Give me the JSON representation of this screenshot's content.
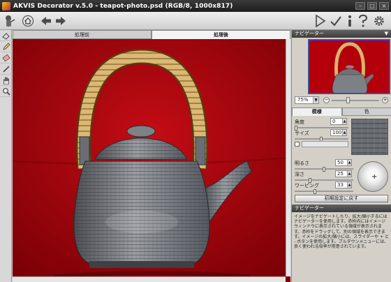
{
  "window": {
    "title": "AKVIS Decorator v.5.0 - teapot-photo.psd (RGB/8, 1000x817)",
    "controls": [
      "–",
      "□",
      "×"
    ]
  },
  "toolbar": {
    "left_icons": [
      "logo-icon",
      "home-icon",
      "undo-icon",
      "redo-icon"
    ],
    "right_icons": [
      "run-icon",
      "apply-icon",
      "info-icon",
      "help-icon",
      "settings-icon"
    ]
  },
  "tools": [
    "eraser-tool-icon",
    "pencil-tool-icon",
    "eraser2-tool-icon",
    "magic-wand-icon",
    "hand-tool-icon",
    "zoom-tool-icon"
  ],
  "canvas_tabs": {
    "before": "処理前",
    "after": "処理後",
    "active": "after"
  },
  "navigator": {
    "title": "ナビゲーター",
    "zoom": "75%",
    "minus": "−",
    "plus": "+"
  },
  "texture_tabs": {
    "texture": "模様",
    "color": "色",
    "active": "texture"
  },
  "texture": {
    "angle_label": "角度",
    "angle_value": "0",
    "size_label": "サイズ",
    "size_value": "100"
  },
  "lighting": {
    "brightness_label": "明るさ",
    "brightness_value": "50",
    "depth_label": "深さ",
    "depth_value": "25",
    "warping_label": "ワーピング",
    "warping_value": "33",
    "sphere_marker": "+"
  },
  "reset_button": "初期設定に戻す",
  "help": {
    "title": "ナビゲーター",
    "text": "イメージをナビゲートしたり、拡大/縮小するにはナビゲーターを使用します。赤枠内にはイメージ ウィンドウに表示されている領域が表示されます。赤枠をドラッグして、別の領域を表示できます。イメージの拡大/縮小には、スライダーや + と - ボタンを使用します。プルダウンメニューには、良く使われる倍率が用意されています。"
  },
  "colors": {
    "background_red": "#a70008",
    "teapot_gray": "#7a7d82",
    "handle_bamboo": "#d6b46e",
    "panel_bg": "#d4d0c8",
    "panel_header": "#4a4a4a"
  }
}
